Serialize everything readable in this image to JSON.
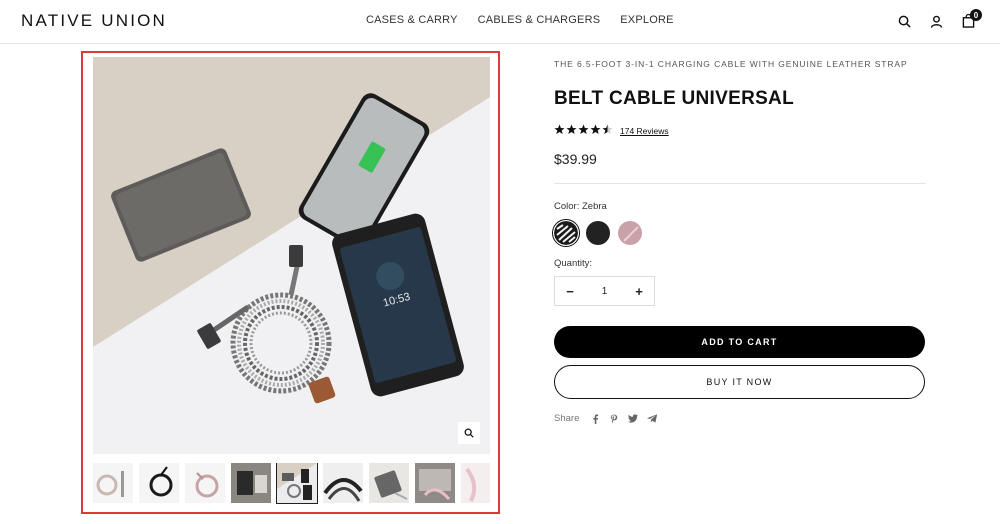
{
  "header": {
    "logo": "NATIVE UNION",
    "nav": [
      "CASES & CARRY",
      "CABLES & CHARGERS",
      "EXPLORE"
    ],
    "cart_count": "0",
    "icons": [
      "search-icon",
      "account-icon",
      "cart-icon"
    ]
  },
  "gallery": {
    "main_image": "belt-cable-flatlay",
    "zoom_icon": "magnifier-icon",
    "thumbnails": [
      "cable-white-coil",
      "cable-black-coil",
      "cable-rose-coil",
      "product-lifestyle",
      "flatlay-selected",
      "cable-zebra-closeup",
      "phone-charging",
      "cable-pink-laptop",
      "cable-pink-partial"
    ],
    "active_index": 4
  },
  "product": {
    "subtitle": "THE 6.5-FOOT 3-IN-1 CHARGING CABLE WITH GENUINE LEATHER STRAP",
    "title": "BELT CABLE UNIVERSAL",
    "rating": 4.5,
    "stars": "★★★★★",
    "reviews": "174 Reviews",
    "price": "$39.99",
    "color_label": "Color:",
    "color_value": "Zebra",
    "swatches": [
      {
        "name": "Zebra",
        "color": "#1a1a1a",
        "selected": true
      },
      {
        "name": "Black",
        "color": "#222222",
        "selected": false
      },
      {
        "name": "Rose",
        "color": "#c9a2a8",
        "selected": false
      }
    ],
    "quantity_label": "Quantity:",
    "quantity": "1",
    "minus": "−",
    "plus": "+",
    "add_to_cart": "ADD TO CART",
    "buy_now": "BUY IT NOW",
    "share_label": "Share",
    "share_icons": [
      "facebook-icon",
      "pinterest-icon",
      "twitter-icon",
      "telegram-icon"
    ]
  },
  "colors": {
    "highlight_border": "#d93a3a",
    "button_dark": "#000000"
  }
}
